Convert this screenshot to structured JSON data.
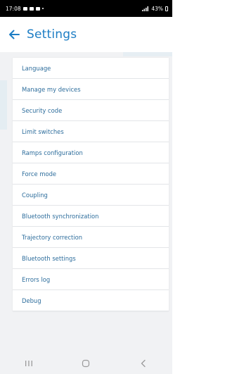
{
  "status_bar": {
    "time": "17:08",
    "battery_text": "43%"
  },
  "header": {
    "title": "Settings",
    "accent_color": "#1c7dc4"
  },
  "menu": {
    "items": [
      {
        "label": "Language"
      },
      {
        "label": "Manage my devices"
      },
      {
        "label": "Security code"
      },
      {
        "label": "Limit switches"
      },
      {
        "label": "Ramps configuration"
      },
      {
        "label": "Force mode"
      },
      {
        "label": "Coupling"
      },
      {
        "label": "Bluetooth synchronization"
      },
      {
        "label": "Trajectory correction"
      },
      {
        "label": "Bluetooth settings"
      },
      {
        "label": "Errors log"
      },
      {
        "label": "Debug"
      }
    ]
  },
  "nav_bar": {
    "icons": [
      "recent-apps-icon",
      "home-icon",
      "back-icon"
    ]
  }
}
